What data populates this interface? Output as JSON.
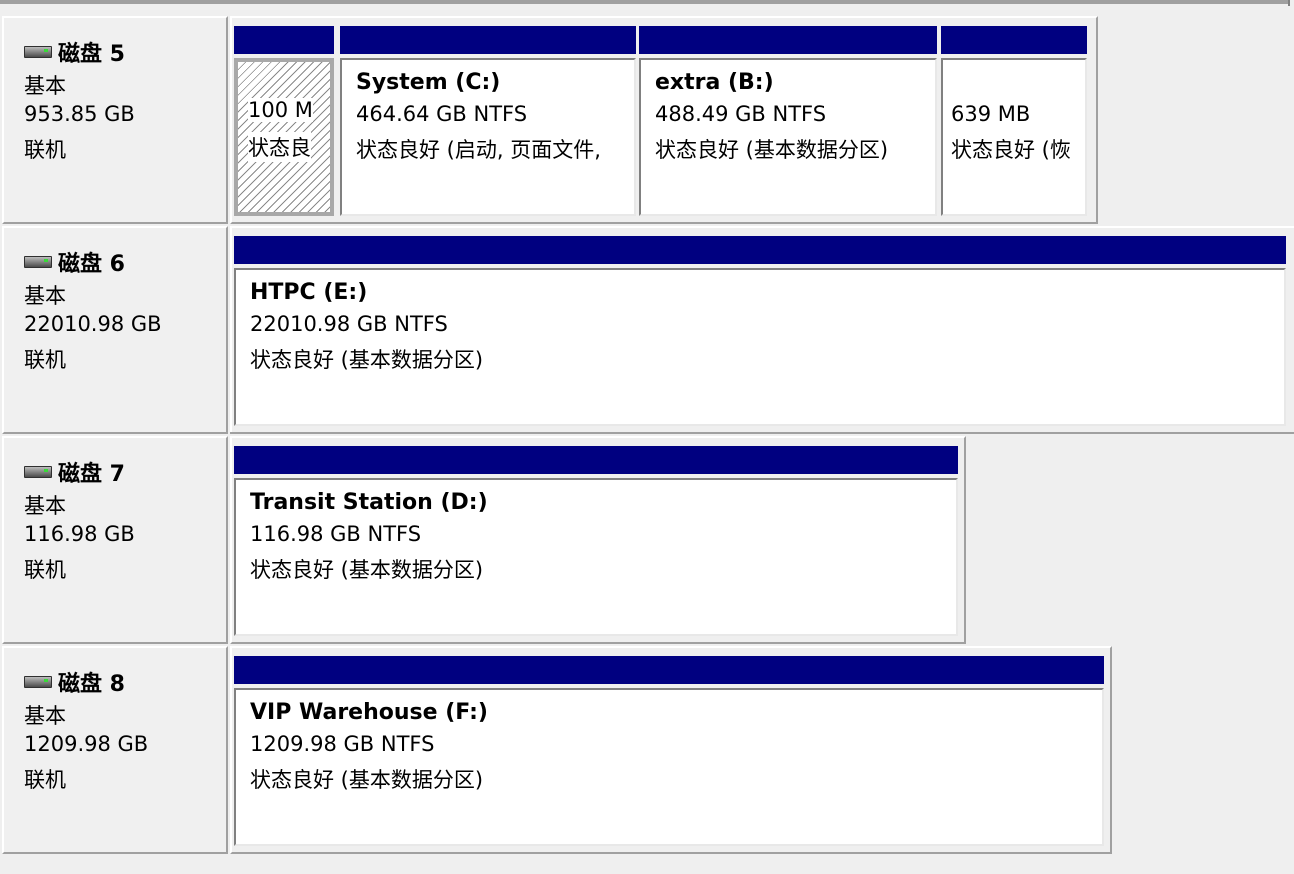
{
  "disks": [
    {
      "name": "磁盘 5",
      "type": "基本",
      "size": "953.85 GB",
      "status": "联机",
      "partitions": [
        {
          "title": "",
          "size": "100 M",
          "status": "状态良"
        },
        {
          "title": "System  (C:)",
          "size": "464.64 GB NTFS",
          "status": "状态良好 (启动, 页面文件,"
        },
        {
          "title": "extra  (B:)",
          "size": "488.49 GB NTFS",
          "status": "状态良好 (基本数据分区)"
        },
        {
          "title": "",
          "size": "639 MB",
          "status": "状态良好 (恢"
        }
      ]
    },
    {
      "name": "磁盘 6",
      "type": "基本",
      "size": "22010.98 GB",
      "status": "联机",
      "partitions": [
        {
          "title": "HTPC  (E:)",
          "size": "22010.98 GB NTFS",
          "status": "状态良好 (基本数据分区)"
        }
      ]
    },
    {
      "name": "磁盘 7",
      "type": "基本",
      "size": "116.98 GB",
      "status": "联机",
      "partitions": [
        {
          "title": "Transit Station  (D:)",
          "size": "116.98 GB NTFS",
          "status": "状态良好 (基本数据分区)"
        }
      ]
    },
    {
      "name": "磁盘 8",
      "type": "基本",
      "size": "1209.98 GB",
      "status": "联机",
      "partitions": [
        {
          "title": "VIP Warehouse  (F:)",
          "size": "1209.98 GB NTFS",
          "status": "状态良好 (基本数据分区)"
        }
      ]
    }
  ],
  "colors": {
    "partition_header": "#000080",
    "background": "#efefef",
    "disk_led": "#38d838"
  },
  "icons": {
    "disk": "hard-disk-icon"
  }
}
